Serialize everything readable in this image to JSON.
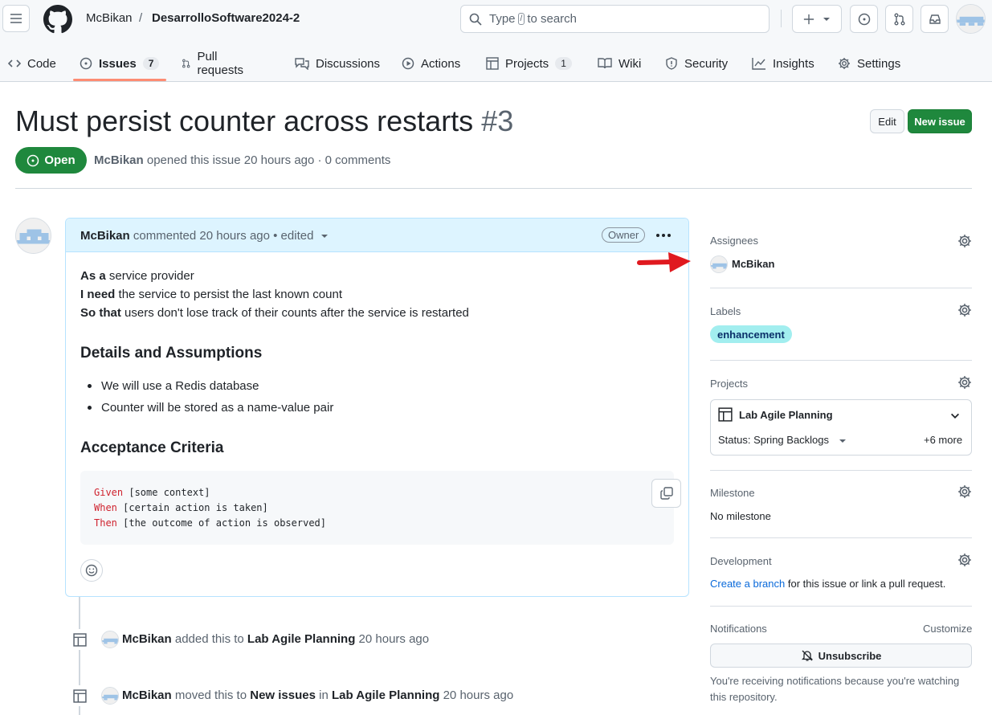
{
  "header": {
    "owner": "McBikan",
    "separator": "/",
    "repo": "DesarrolloSoftware2024-2",
    "search_prefix": "Type",
    "search_key": "/",
    "search_suffix": "to search"
  },
  "tabs": [
    {
      "label": "Code",
      "icon": "code-icon"
    },
    {
      "label": "Issues",
      "icon": "issue-icon",
      "count": "7"
    },
    {
      "label": "Pull requests",
      "icon": "pull-request-icon"
    },
    {
      "label": "Discussions",
      "icon": "discussion-icon"
    },
    {
      "label": "Actions",
      "icon": "play-icon"
    },
    {
      "label": "Projects",
      "icon": "table-icon",
      "count": "1"
    },
    {
      "label": "Wiki",
      "icon": "book-icon"
    },
    {
      "label": "Security",
      "icon": "shield-icon"
    },
    {
      "label": "Insights",
      "icon": "graph-icon"
    },
    {
      "label": "Settings",
      "icon": "gear-icon"
    }
  ],
  "issue": {
    "title": "Must persist counter across restarts",
    "number": "#3",
    "edit_label": "Edit",
    "new_label": "New issue",
    "state": "Open",
    "author": "McBikan",
    "opened_text": "opened this issue 20 hours ago · 0 comments"
  },
  "comment": {
    "author": "McBikan",
    "meta": "commented 20 hours ago • edited",
    "role": "Owner",
    "story": [
      {
        "lead": "As a",
        "rest": " service provider"
      },
      {
        "lead": "I need",
        "rest": " the service to persist the last known count"
      },
      {
        "lead": "So that",
        "rest": " users don't lose track of their counts after the service is restarted"
      }
    ],
    "h_details": "Details and Assumptions",
    "bullets": [
      "We will use a Redis database",
      "Counter will be stored as a name-value pair"
    ],
    "h_acceptance": "Acceptance Criteria",
    "code": [
      {
        "kw": "Given",
        "rest": " [some context]"
      },
      {
        "kw": "When",
        "rest": " [certain action is taken]"
      },
      {
        "kw": "Then",
        "rest": " [the outcome of action is observed]"
      }
    ]
  },
  "timeline": [
    {
      "actor": "McBikan",
      "verb": " added this to ",
      "target": "Lab Agile Planning",
      "time": " 20 hours ago"
    },
    {
      "actor": "McBikan",
      "verb": " moved this to ",
      "column": "New issues",
      "mid": " in ",
      "target": "Lab Agile Planning",
      "time": " 20 hours ago"
    }
  ],
  "sidebar": {
    "assignees_label": "Assignees",
    "assignee": "McBikan",
    "labels_label": "Labels",
    "label": "enhancement",
    "label_color": "#a2eeef",
    "projects_label": "Projects",
    "project_name": "Lab Agile Planning",
    "project_status": "Status: Spring Backlogs",
    "project_more": "+6 more",
    "milestone_label": "Milestone",
    "milestone_value": "No milestone",
    "development_label": "Development",
    "dev_link": "Create a branch",
    "dev_rest": " for this issue or link a pull request.",
    "notifications_label": "Notifications",
    "customize": "Customize",
    "unsubscribe": "Unsubscribe",
    "notification_note": "You're receiving notifications because you're watching this repository."
  },
  "colors": {
    "accent_green": "#1f883d",
    "tab_underline": "#fd8c73",
    "annotation_arrow": "#e0191f"
  }
}
